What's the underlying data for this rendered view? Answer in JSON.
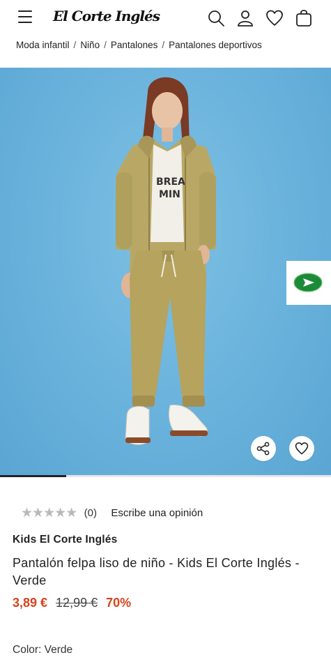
{
  "header": {
    "logo": "El Corte Inglés",
    "icons": [
      "menu-icon",
      "search-icon",
      "user-icon",
      "heart-icon",
      "bag-icon"
    ]
  },
  "breadcrumb": [
    "Moda infantil",
    "Niño",
    "Pantalones",
    "Pantalones deportivos"
  ],
  "gallery": {
    "progress": 0.2
  },
  "rating": {
    "stars": "★★★★★",
    "count": "(0)",
    "review_link": "Escribe una opinión"
  },
  "product": {
    "brand": "Kids El Corte Inglés",
    "title": "Pantalón felpa liso de niño - Kids El Corte Inglés - Verde",
    "price_now": "3,89 €",
    "price_old": "12,99 €",
    "discount": "70%",
    "color_label": "Color:",
    "color_value": "Verde"
  },
  "colors": {
    "accent_price": "#d6441e",
    "background_image": "#69b2dc",
    "badge_green": "#1d8a3a"
  }
}
